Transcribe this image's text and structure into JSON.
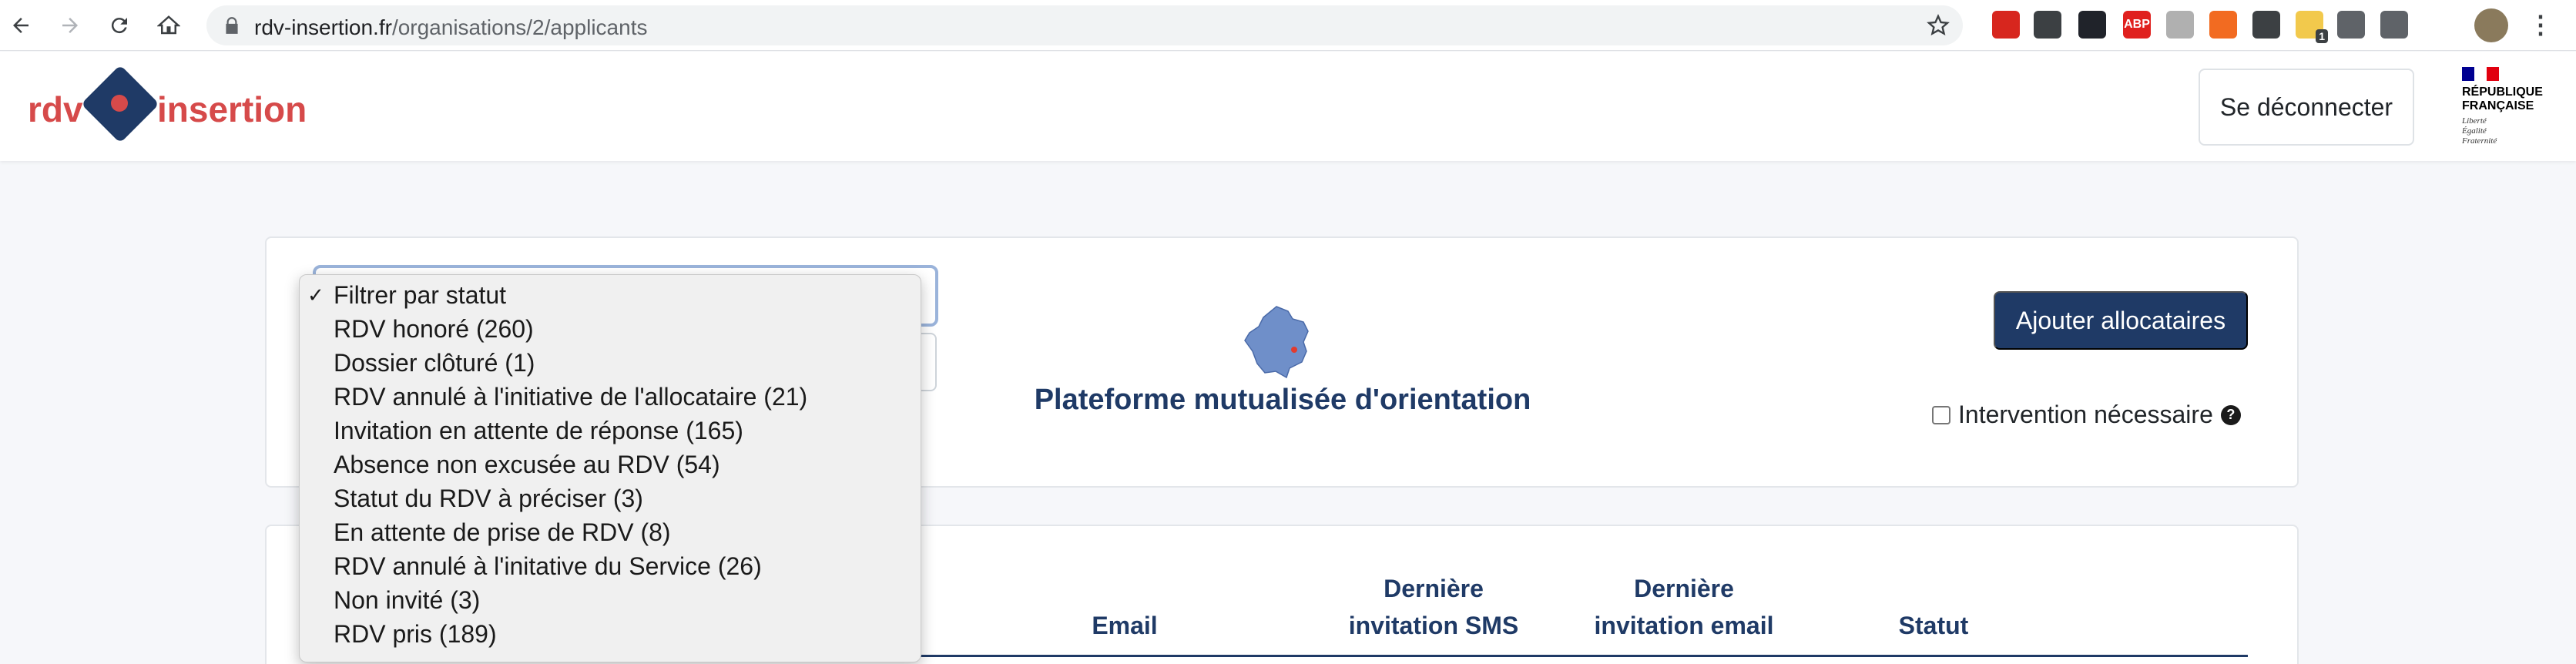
{
  "browser": {
    "url_host": "rdv-insertion.fr",
    "url_path": "/organisations/2/applicants",
    "extensions": [
      {
        "name": "shield-extension-icon",
        "color": "#d7261e"
      },
      {
        "name": "eyedropper-extension-icon",
        "color": "#3c4043"
      },
      {
        "name": "react-devtools-extension-icon",
        "color": "#20232a"
      },
      {
        "name": "adblock-plus-extension-icon",
        "color": "#e0201e",
        "label": "ABP"
      },
      {
        "name": "clock-extension-icon",
        "color": "#b0b0b0"
      },
      {
        "name": "translate-extension-icon",
        "color": "#f26b21"
      },
      {
        "name": "clipboard-extension-icon",
        "color": "#3c4043"
      },
      {
        "name": "notes-extension-icon",
        "color": "#f2c94c",
        "badge": "1"
      },
      {
        "name": "puzzle-extensions-icon",
        "color": "#5f6368"
      },
      {
        "name": "reading-list-icon",
        "color": "#5f6368"
      }
    ]
  },
  "header": {
    "logo_left": "rdv",
    "logo_right": "insertion",
    "logout_label": "Se déconnecter",
    "republic_lines": [
      "RÉPUBLIQUE",
      "FRANÇAISE"
    ],
    "motto_lines": [
      "Liberté",
      "Égalité",
      "Fraternité"
    ],
    "colors": {
      "primary": "#1f3a66",
      "brand_red": "#d64a4a"
    }
  },
  "filters": {
    "status_options": [
      {
        "label": "Filtrer par statut",
        "selected": true
      },
      {
        "label": "RDV honoré (260)"
      },
      {
        "label": "Dossier clôturé (1)"
      },
      {
        "label": "RDV annulé à l'initiative de l'allocataire (21)"
      },
      {
        "label": "Invitation en attente de réponse (165)"
      },
      {
        "label": "Absence non excusée au RDV (54)"
      },
      {
        "label": "Statut du RDV à préciser (3)"
      },
      {
        "label": "En attente de prise de RDV (8)"
      },
      {
        "label": "RDV annulé à l'initative du Service (26)"
      },
      {
        "label": "Non invité (3)"
      },
      {
        "label": "RDV pris (189)"
      }
    ],
    "check_mark": "✓"
  },
  "main": {
    "platform_title": "Plateforme mutualisée d'orientation",
    "add_button": "Ajouter allocataires",
    "intervention_label": "Intervention nécessaire",
    "help_icon": "?"
  },
  "table": {
    "headers": {
      "email": "Email",
      "last_sms": [
        "Dernière",
        "invitation SMS"
      ],
      "last_email": [
        "Dernière",
        "invitation email"
      ],
      "status": "Statut"
    }
  }
}
